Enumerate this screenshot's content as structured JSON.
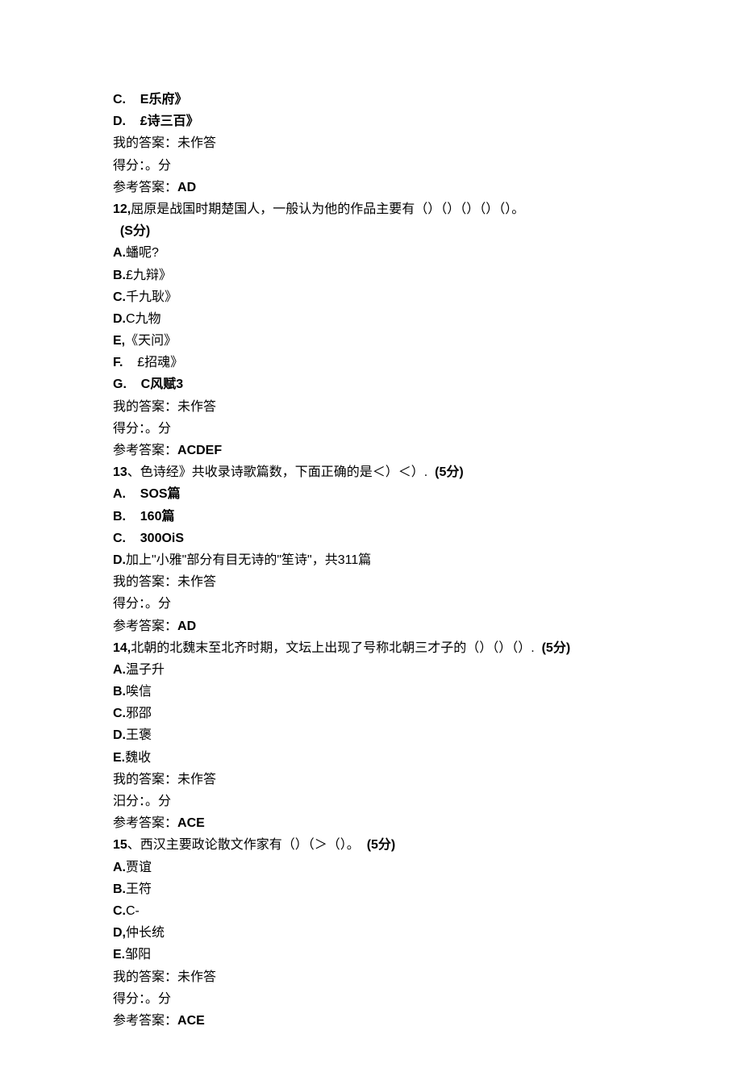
{
  "q11_tail": {
    "options": [
      {
        "label": "C.",
        "text": "E乐府》"
      },
      {
        "label": "D.",
        "text": "£诗三百》"
      }
    ],
    "my_answer_label": "我的答案：未作答",
    "score_label": "得分：。分",
    "ref_label": "参考答案：",
    "ref_value": "AD"
  },
  "q12": {
    "num": "12,",
    "stem": "屈原是战国时期楚国人，一般认为他的作品主要有（）（）（）（）（）。",
    "points": "(S分)",
    "options": [
      {
        "label": "A.",
        "text": "蟠呢?"
      },
      {
        "label": "B.",
        "text": "£九辩》"
      },
      {
        "label": "C.",
        "text": "千九耿》"
      },
      {
        "label": "D.",
        "text": "C九物"
      },
      {
        "label": "E,",
        "text": "《天问》"
      },
      {
        "label": "F.",
        "text": "£招魂》"
      },
      {
        "label": "G.",
        "text": "C风赋3"
      }
    ],
    "my_answer_label": "我的答案：未作答",
    "score_label": "得分：。分",
    "ref_label": "参考答案：",
    "ref_value": "ACDEF"
  },
  "q13": {
    "num": "13",
    "stem": "、色诗经》共收录诗歌篇数，下面正确的是＜）＜）.",
    "points": "(5分)",
    "options": [
      {
        "label": "A.",
        "text": "SOS篇"
      },
      {
        "label": "B.",
        "text": "160篇"
      },
      {
        "label": "C.",
        "text": "300OiS"
      },
      {
        "label": "D.",
        "text": "加上\"小雅\"部分有目无诗的\"笙诗\"，共311篇"
      }
    ],
    "my_answer_label": "我的答案：未作答",
    "score_label": "得分：。分",
    "ref_label": "参考答案：",
    "ref_value": "AD"
  },
  "q14": {
    "num": "14,",
    "stem": "北朝的北魏末至北齐时期，文坛上出现了号称北朝三才子的（）（）（）.",
    "points": "(5分)",
    "options": [
      {
        "label": "A.",
        "text": "温子升"
      },
      {
        "label": "B.",
        "text": "唉信"
      },
      {
        "label": "C.",
        "text": "邪邵"
      },
      {
        "label": "D.",
        "text": "王褒"
      },
      {
        "label": "E.",
        "text": "魏收"
      }
    ],
    "my_answer_label": "我的答案：未作答",
    "score_label": "汨分：。分",
    "ref_label": "参考答案：",
    "ref_value": "ACE"
  },
  "q15": {
    "num": "15",
    "stem": "、西汉主要政论散文作家有（）（＞（）。",
    "points": "(5分)",
    "options": [
      {
        "label": "A.",
        "text": "贾谊"
      },
      {
        "label": "B.",
        "text": "王符"
      },
      {
        "label": "C.",
        "text": "C-"
      },
      {
        "label": "D,",
        "text": "仲长统"
      },
      {
        "label": "E.",
        "text": "邹阳"
      }
    ],
    "my_answer_label": "我的答案：未作答",
    "score_label": "得分：。分",
    "ref_label": "参考答案：",
    "ref_value": "ACE"
  }
}
